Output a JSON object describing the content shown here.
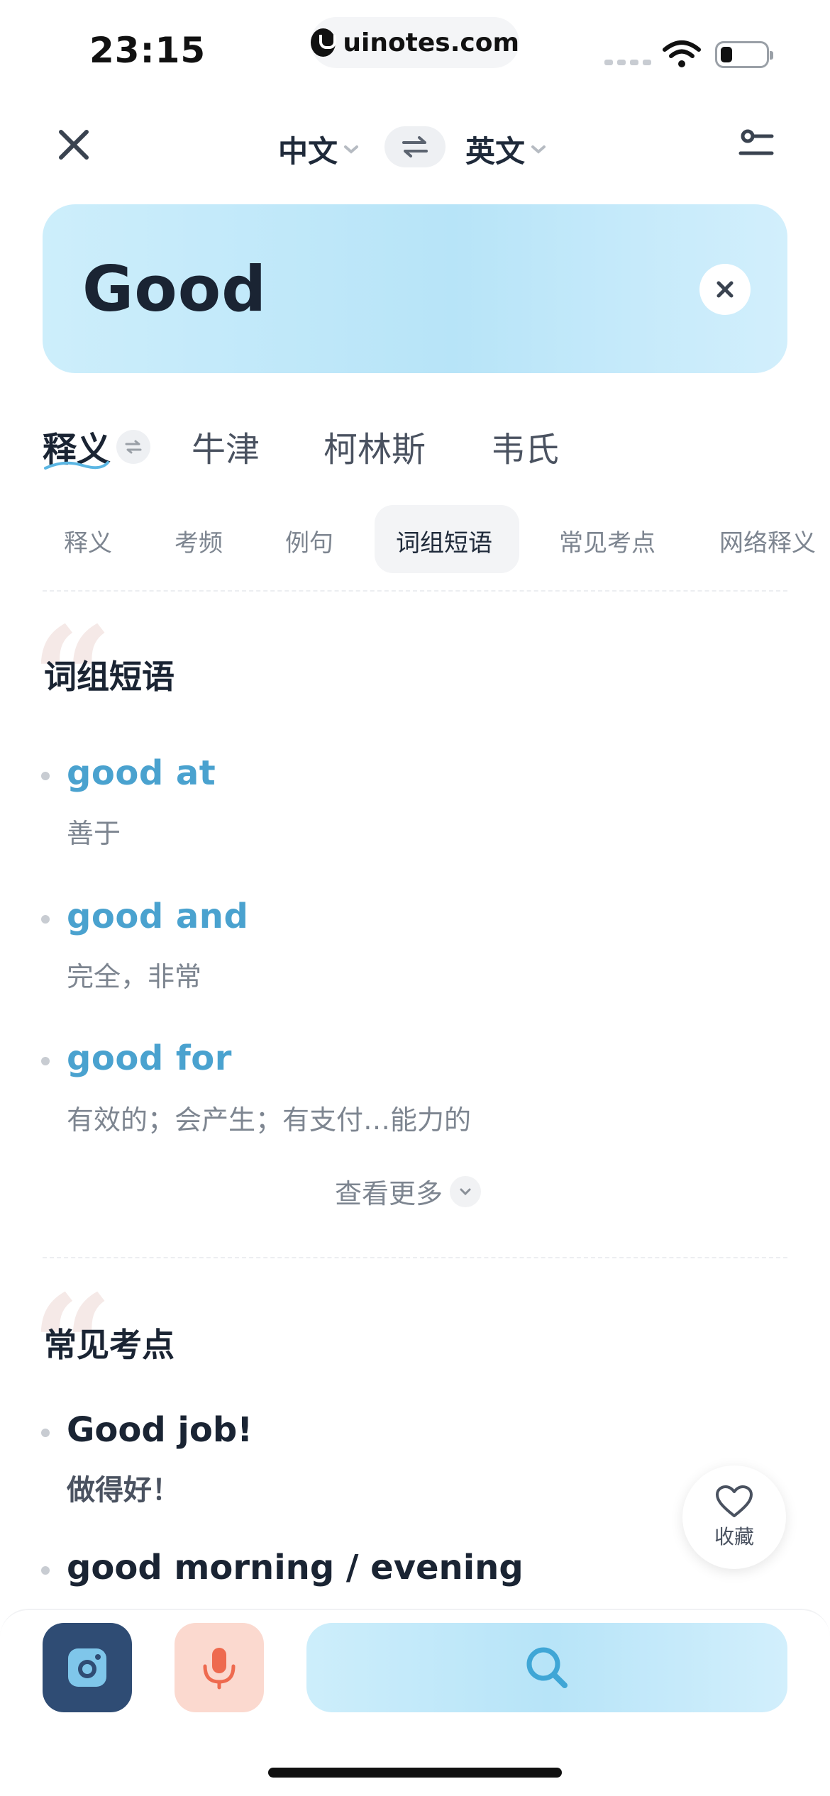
{
  "status": {
    "time": "23:15",
    "url": "uinotes.com"
  },
  "nav": {
    "source_lang": "中文",
    "target_lang": "英文"
  },
  "search": {
    "query": "Good"
  },
  "dict_tabs": [
    "释义",
    "牛津",
    "柯林斯",
    "韦氏"
  ],
  "section_tabs": [
    "释义",
    "考频",
    "例句",
    "词组短语",
    "常见考点",
    "网络释义"
  ],
  "active_section_tab": "词组短语",
  "phrases_section": {
    "title": "词组短语",
    "items": [
      {
        "phrase": "good at",
        "meaning": "善于"
      },
      {
        "phrase": "good and",
        "meaning": "完全，非常"
      },
      {
        "phrase": "good for",
        "meaning": "有效的；会产生；有支付…能力的"
      }
    ],
    "more_label": "查看更多"
  },
  "exam_section": {
    "title": "常见考点",
    "items": [
      {
        "phrase": "Good job!",
        "meaning": "做得好！"
      },
      {
        "phrase": "good morning / evening",
        "meaning": ""
      }
    ]
  },
  "favorite": {
    "label": "收藏"
  },
  "colors": {
    "accent": "#4aa2cf",
    "card": "#c5eafa",
    "camera": "#2f4c74",
    "mic": "#fbd9cf"
  }
}
